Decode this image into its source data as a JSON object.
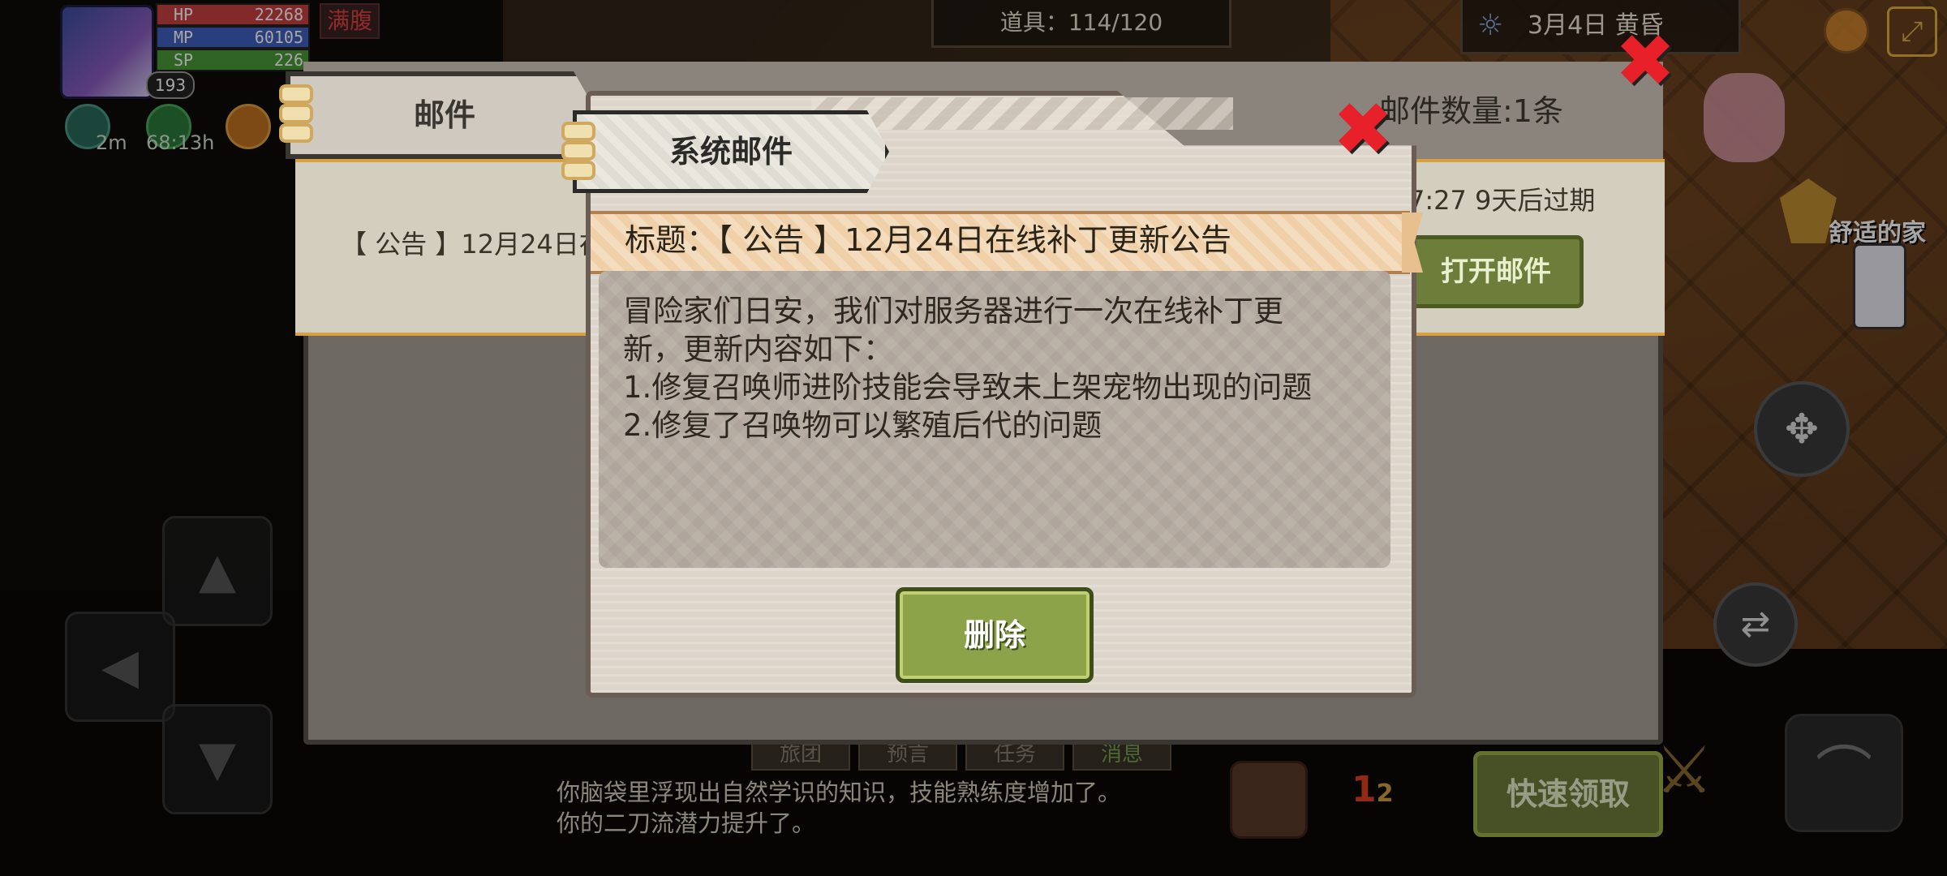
{
  "hud": {
    "level": "193",
    "hp": {
      "label": "HP",
      "value": "22268"
    },
    "mp": {
      "label": "MP",
      "value": "60105"
    },
    "sp": {
      "label": "SP",
      "value": "226"
    },
    "status_badge": "满腹",
    "buff_times": [
      "2m",
      "68:13h"
    ],
    "items": "道具：114/120",
    "date": "3月4日  黄昏"
  },
  "mail_panel": {
    "tab_label": "邮件",
    "count_label": "邮件数量:1条",
    "row_title": "【 公告 】12月24日在",
    "row_time": "7:27  9天后过期",
    "open_button": "打开邮件"
  },
  "dialog": {
    "tab_label": "系统邮件",
    "subject": "标题：【 公告 】12月24日在线补丁更新公告",
    "body_lines": [
      "冒险家们日安，我们对服务器进行一次在线补丁更",
      "新，更新内容如下：",
      "1.修复召唤师进阶技能会导致未上架宠物出现的问题",
      "2.修复了召唤物可以繁殖后代的问题"
    ],
    "delete_button": "删除"
  },
  "world": {
    "home_label": "舒适的家",
    "quick_claim": "快速领取",
    "bottom_tabs": [
      "旅团",
      "预言",
      "任务",
      "消息"
    ],
    "log_lines": [
      "你脑袋里浮现出自然学识的知识，技能熟练度增加了。",
      "你的二刀流潜力提升了。"
    ]
  }
}
